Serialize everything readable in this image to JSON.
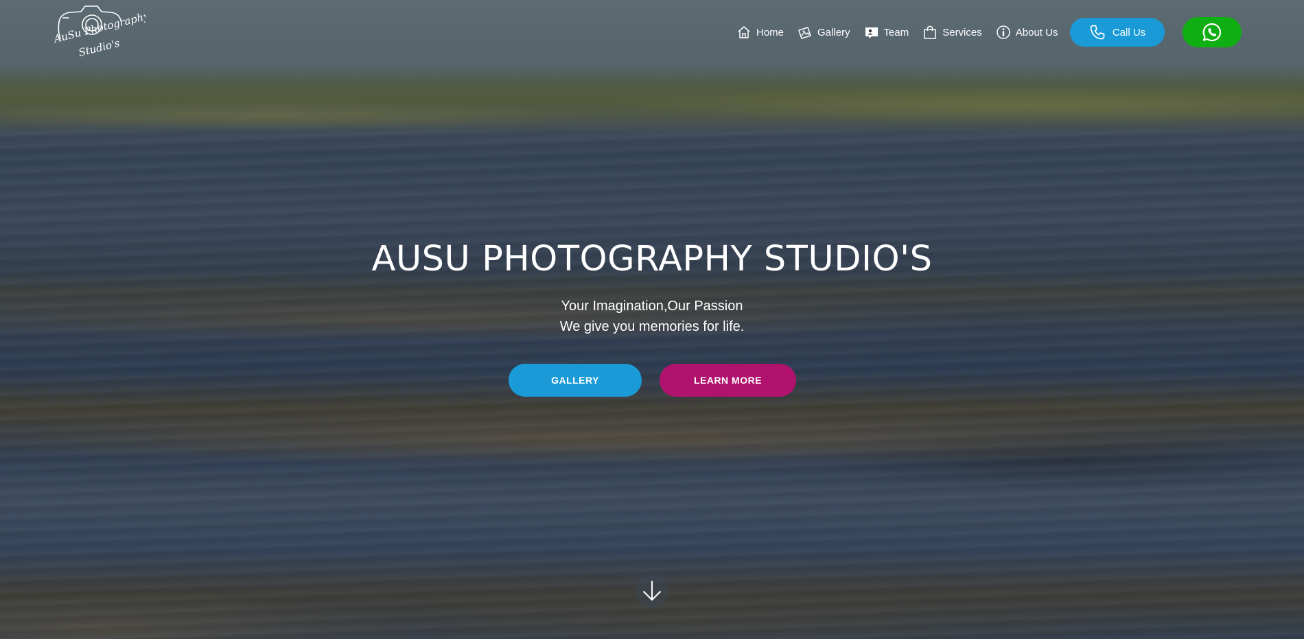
{
  "brand": {
    "logo_text_line1": "AuSu Photography",
    "logo_text_line2": "Studio's"
  },
  "nav": {
    "items": [
      {
        "label": "Home",
        "icon": "home-icon"
      },
      {
        "label": "Gallery",
        "icon": "images-icon"
      },
      {
        "label": "Team",
        "icon": "team-icon"
      },
      {
        "label": "Services",
        "icon": "shopping-bag-icon"
      },
      {
        "label": "About Us",
        "icon": "info-icon"
      }
    ],
    "call_label": "Call Us",
    "call_icon": "phone-icon",
    "whatsapp_icon": "whatsapp-icon"
  },
  "hero": {
    "title": "AUSU PHOTOGRAPHY STUDIO'S",
    "subtitle_line1": "Your Imagination,Our Passion",
    "subtitle_line2": "We give you memories for life.",
    "gallery_button": "GALLERY",
    "learn_more_button": "LEARN MORE",
    "scroll_icon": "arrow-down-icon"
  },
  "colors": {
    "primary_blue": "#1a9bd7",
    "magenta": "#b0126e",
    "whatsapp_green": "#0fae12",
    "text": "#ffffff"
  }
}
